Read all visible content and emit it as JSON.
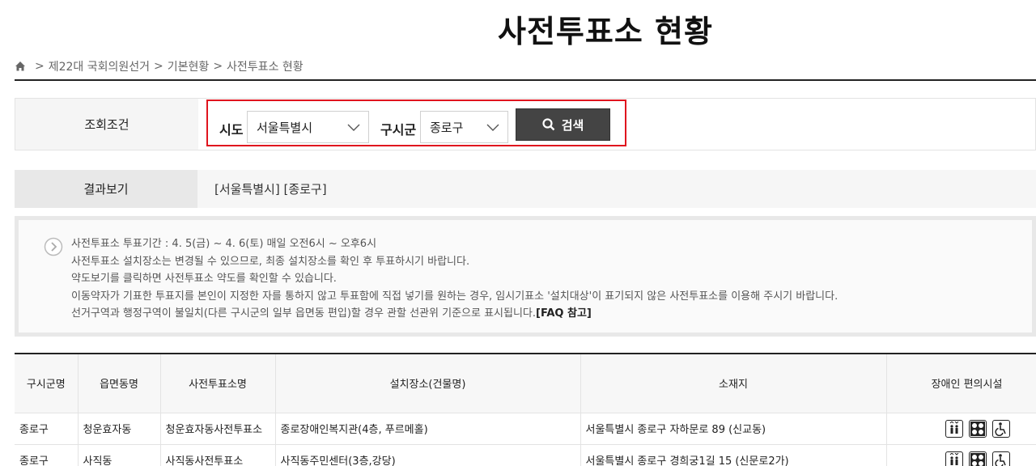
{
  "page_title": "사전투표소 현황",
  "breadcrumb": {
    "home_icon": "home-icon",
    "items": [
      "제22대 국회의원선거",
      "기본현황",
      "사전투표소 현황"
    ]
  },
  "search": {
    "label": "조회조건",
    "sido_label": "시도",
    "sido_value": "서울특별시",
    "sigungu_label": "구시군",
    "sigungu_value": "종로구",
    "button_label": "검색",
    "highlight_color": "#e0141e"
  },
  "result": {
    "label": "결과보기",
    "value": "[서울특별시] [종로구]"
  },
  "notice": {
    "lines": [
      "사전투표소 투표기간 : 4. 5(금) ~ 4. 6(토) 매일 오전6시 ~ 오후6시",
      "사전투표소 설치장소는 변경될 수 있으므로, 최종 설치장소를 확인 후 투표하시기 바랍니다.",
      "약도보기를 클릭하면 사전투표소 약도를 확인할 수 있습니다.",
      "이동약자가 기표한 투표지를 본인이 지정한 자를 통하지 않고 투표함에 직접 넣기를 원하는 경우, 임시기표소 '설치대상'이 표기되지 않은 사전투표소를 이용해 주시기 바랍니다.",
      "선거구역과 행정구역이 불일치(다른 구시군의 일부 읍면동 편입)할 경우 관할 선관위 기준으로 표시됩니다."
    ],
    "faq_link": "[FAQ 참고]"
  },
  "table": {
    "headers": [
      "구시군명",
      "읍면동명",
      "사전투표소명",
      "설치장소(건물명)",
      "소재지",
      "장애인 편의시설"
    ],
    "rows": [
      {
        "sigungu": "종로구",
        "dong": "청운효자동",
        "station": "청운효자동사전투표소",
        "place": "종로장애인복지관(4층, 푸르메홀)",
        "address": "서울특별시 종로구 자하문로 89 (신교동)",
        "facilities": [
          "elevator-icon",
          "braille-icon",
          "wheelchair-icon"
        ]
      },
      {
        "sigungu": "종로구",
        "dong": "사직동",
        "station": "사직동사전투표소",
        "place": "사직동주민센터(3층,강당)",
        "address": "서울특별시 종로구 경희궁1길 15 (신문로2가)",
        "facilities": [
          "elevator-icon",
          "braille-icon",
          "wheelchair-icon"
        ]
      }
    ]
  }
}
